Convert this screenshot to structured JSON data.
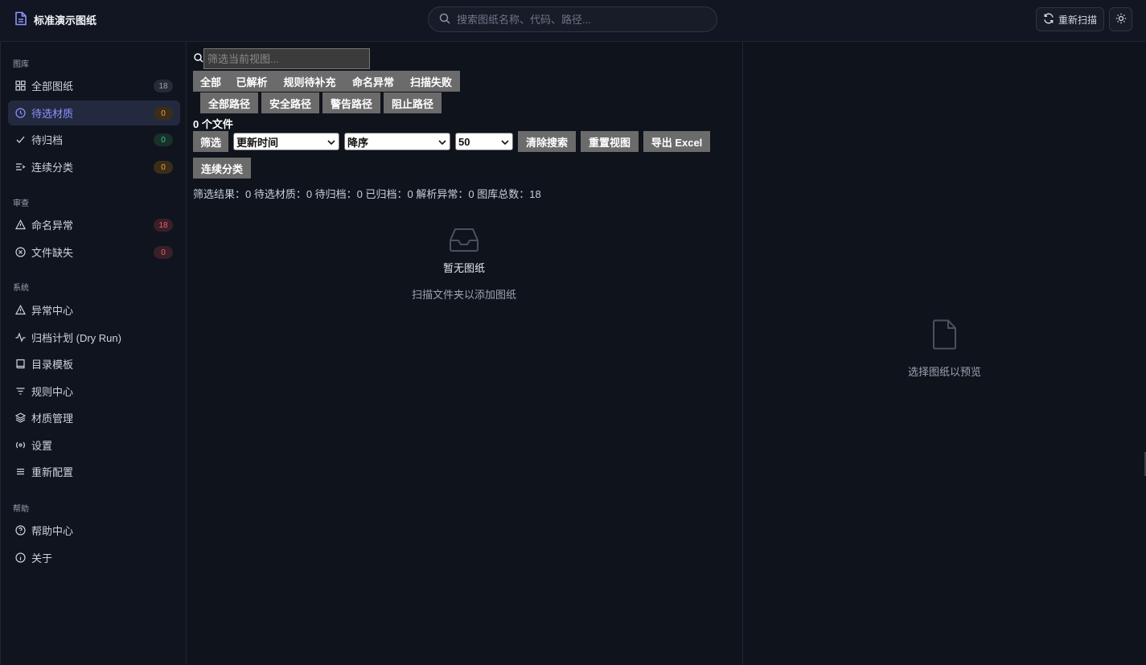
{
  "header": {
    "app_title": "标准演示图纸",
    "search_placeholder": "搜索图纸名称、代码、路径...",
    "rescan_label": "重新扫描"
  },
  "sidebar": {
    "sections": [
      {
        "label": "图库"
      },
      {
        "label": "审查"
      },
      {
        "label": "系统"
      },
      {
        "label": "帮助"
      }
    ],
    "library": [
      {
        "label": "全部图纸",
        "count": "18",
        "icon": "grid-icon"
      },
      {
        "label": "待选材质",
        "count": "0",
        "icon": "clock-icon",
        "active": true
      },
      {
        "label": "待归档",
        "count": "0",
        "icon": "check-icon"
      },
      {
        "label": "连续分类",
        "count": "0",
        "icon": "list-arrow-icon"
      }
    ],
    "review": [
      {
        "label": "命名异常",
        "count": "18",
        "icon": "warning-icon"
      },
      {
        "label": "文件缺失",
        "count": "0",
        "icon": "circle-x-icon"
      }
    ],
    "system": [
      {
        "label": "异常中心",
        "icon": "warning-icon"
      },
      {
        "label": "归档计划 (Dry Run)",
        "icon": "activity-icon"
      },
      {
        "label": "目录模板",
        "icon": "book-icon"
      },
      {
        "label": "规则中心",
        "icon": "filter-icon"
      },
      {
        "label": "材质管理",
        "icon": "layers-icon"
      },
      {
        "label": "设置",
        "icon": "radio-icon"
      },
      {
        "label": "重新配置",
        "icon": "menu-icon"
      }
    ],
    "help": [
      {
        "label": "帮助中心",
        "icon": "help-circle-icon"
      },
      {
        "label": "关于",
        "icon": "info-icon"
      }
    ]
  },
  "main": {
    "filter_placeholder": "筛选当前视图...",
    "status_tabs": [
      "全部",
      "已解析",
      "规则待补充",
      "命名异常",
      "扫描失败"
    ],
    "path_tabs": [
      "全部路径",
      "安全路径",
      "警告路径",
      "阻止路径"
    ],
    "file_count": "0 个文件",
    "filter_button": "筛选",
    "sort_field": "更新时间",
    "sort_order": "降序",
    "page_size": "50",
    "clear_search": "清除搜索",
    "reset_view": "重置视图",
    "export_excel": "导出 Excel",
    "continuous_classify": "连续分类",
    "stats": "筛选结果：0  待选材质：0  待归档：0  已归档：0  解析异常：0  图库总数：18",
    "empty_title": "暂无图纸",
    "empty_subtitle": "扫描文件夹以添加图纸"
  },
  "preview": {
    "empty_text": "选择图纸以预览"
  },
  "colors": {
    "accent": "#8b93ff",
    "background": "#0f131c",
    "badge_orange": "#e9a23b",
    "badge_green": "#3ec28a",
    "badge_red": "#e2626f"
  }
}
